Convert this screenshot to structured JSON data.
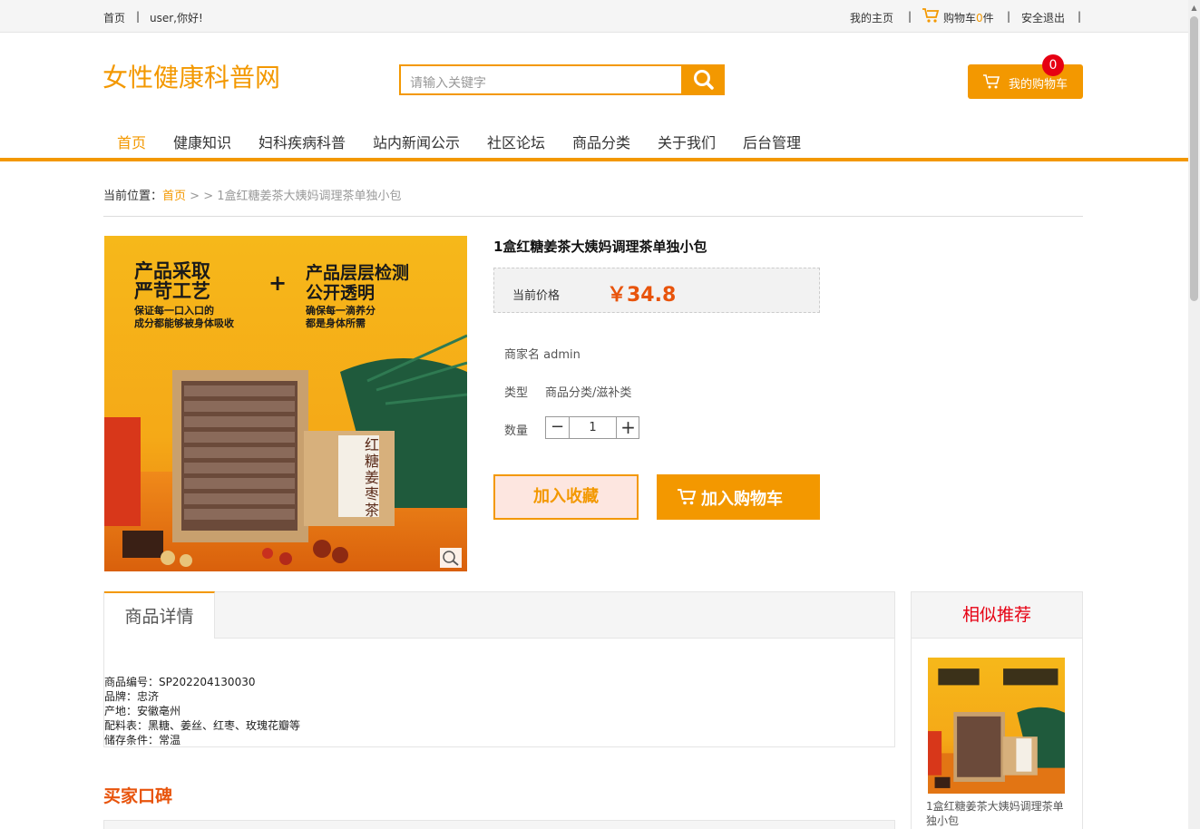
{
  "topbar": {
    "home": "首页",
    "separator": "|",
    "greeting": "user,你好!",
    "my_home": "我的主页",
    "cart_prefix": "购物车",
    "cart_count": "0",
    "cart_suffix": "件",
    "logout": "安全退出"
  },
  "header": {
    "logo": "女性健康科普网",
    "search_placeholder": "请输入关键字",
    "cart_button": "我的购物车",
    "cart_badge": "0"
  },
  "nav": {
    "items": [
      "首页",
      "健康知识",
      "妇科疾病科普",
      "站内新闻公示",
      "社区论坛",
      "商品分类",
      "关于我们",
      "后台管理"
    ]
  },
  "breadcrumb": {
    "label": "当前位置：",
    "home": "首页",
    "separator": " > > ",
    "current": "1盒红糖姜茶大姨妈调理茶单独小包"
  },
  "product": {
    "title": "1盒红糖姜茶大姨妈调理茶单独小包",
    "price_label": "当前价格",
    "price": "￥34.8",
    "merchant": "商家名 admin",
    "type_label": "类型",
    "type_value": "商品分类/滋补类",
    "qty_label": "数量",
    "qty_minus": "−",
    "qty_value": "1",
    "qty_plus": "+",
    "fav_button": "加入收藏",
    "cart_button": "加入购物车",
    "image": {
      "headline_left_1": "产品采取",
      "headline_left_2": "严苛工艺",
      "plus": "+",
      "headline_right_1": "产品层层检测",
      "headline_right_2": "公开透明",
      "sub_left_1": "保证每一口入口的",
      "sub_left_2": "成分都能够被身体吸收",
      "sub_right_1": "确保每一滴养分",
      "sub_right_2": "都是身体所需",
      "box_label": "红糖姜枣茶"
    }
  },
  "details": {
    "tab": "商品详情",
    "lines": [
      "商品编号：SP202204130030",
      "品牌：忠济",
      "产地：安徽亳州",
      "配料表：黑糖、姜丝、红枣、玫瑰花瓣等",
      "储存条件：常温"
    ]
  },
  "recommend": {
    "title": "相似推荐",
    "item_name": "1盒红糖姜茶大姨妈调理茶单独小包"
  },
  "reviews": {
    "title": "买家口碑"
  },
  "colors": {
    "accent": "#f39800",
    "price": "#e8540c",
    "badge": "#e60012"
  }
}
